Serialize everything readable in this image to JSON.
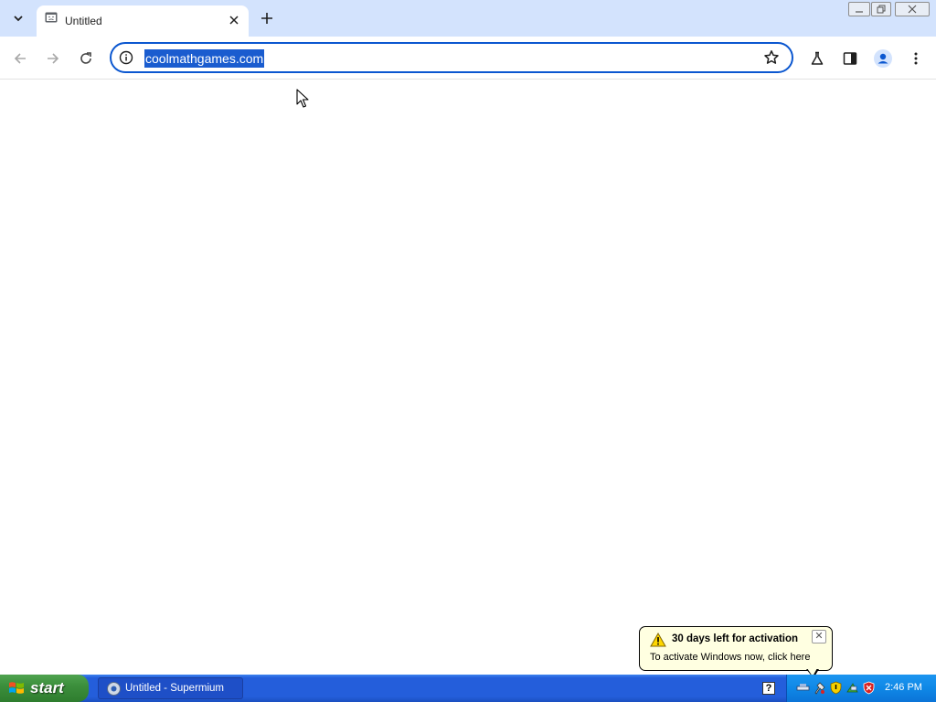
{
  "browser": {
    "tab": {
      "title": "Untitled",
      "close_glyph": "✕"
    },
    "new_tab_glyph": "+",
    "omnibox": {
      "url": "coolmathgames.com"
    },
    "accent": "#0b57d0",
    "tabstrip_color": "#d3e3fd"
  },
  "notification": {
    "title": "30 days left for activation",
    "text": "To activate Windows now, click here",
    "close_glyph": "✕"
  },
  "taskbar": {
    "start_label": "start",
    "task_item_label": "Untitled - Supermium",
    "help_glyph": "?",
    "clock": "2:46 PM"
  }
}
